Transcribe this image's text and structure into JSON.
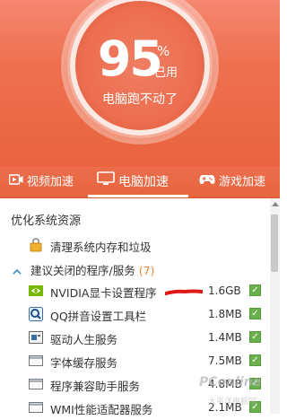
{
  "gauge": {
    "percent": "95",
    "percent_sign": "%",
    "used_label": "已用",
    "caption": "电脑跑不动了"
  },
  "tabs": [
    {
      "label": "视频加速",
      "icon": "video-icon",
      "active": false
    },
    {
      "label": "电脑加速",
      "icon": "monitor-icon",
      "active": true
    },
    {
      "label": "游戏加速",
      "icon": "gamepad-icon",
      "active": false
    }
  ],
  "section": {
    "title": "优化系统资源",
    "clean_item": "清理系统内存和垃圾",
    "group_label": "建议关闭的程序/服务",
    "group_count": "(7)"
  },
  "programs": [
    {
      "name": "NVIDIA显卡设置程序",
      "size": "1.6GB",
      "checked": true,
      "icon": "nvidia-icon"
    },
    {
      "name": "QQ拼音设置工具栏",
      "size": "1.8MB",
      "checked": true,
      "icon": "qq-pinyin-icon"
    },
    {
      "name": "驱动人生服务",
      "size": "1.4MB",
      "checked": true,
      "icon": "driver-icon"
    },
    {
      "name": "字体缓存服务",
      "size": "7.5MB",
      "checked": true,
      "icon": "service-icon"
    },
    {
      "name": "程序兼容助手服务",
      "size": "4.8MB",
      "checked": true,
      "icon": "service-icon"
    },
    {
      "name": "WMI性能适配器服务",
      "size": "2.1MB",
      "checked": true,
      "icon": "service-icon"
    }
  ],
  "watermark": {
    "text": "PConline",
    "sub": "太平洋电脑网"
  },
  "colors": {
    "header": "#ee6f4f",
    "check": "#6ab04c",
    "count": "#e8853a"
  }
}
